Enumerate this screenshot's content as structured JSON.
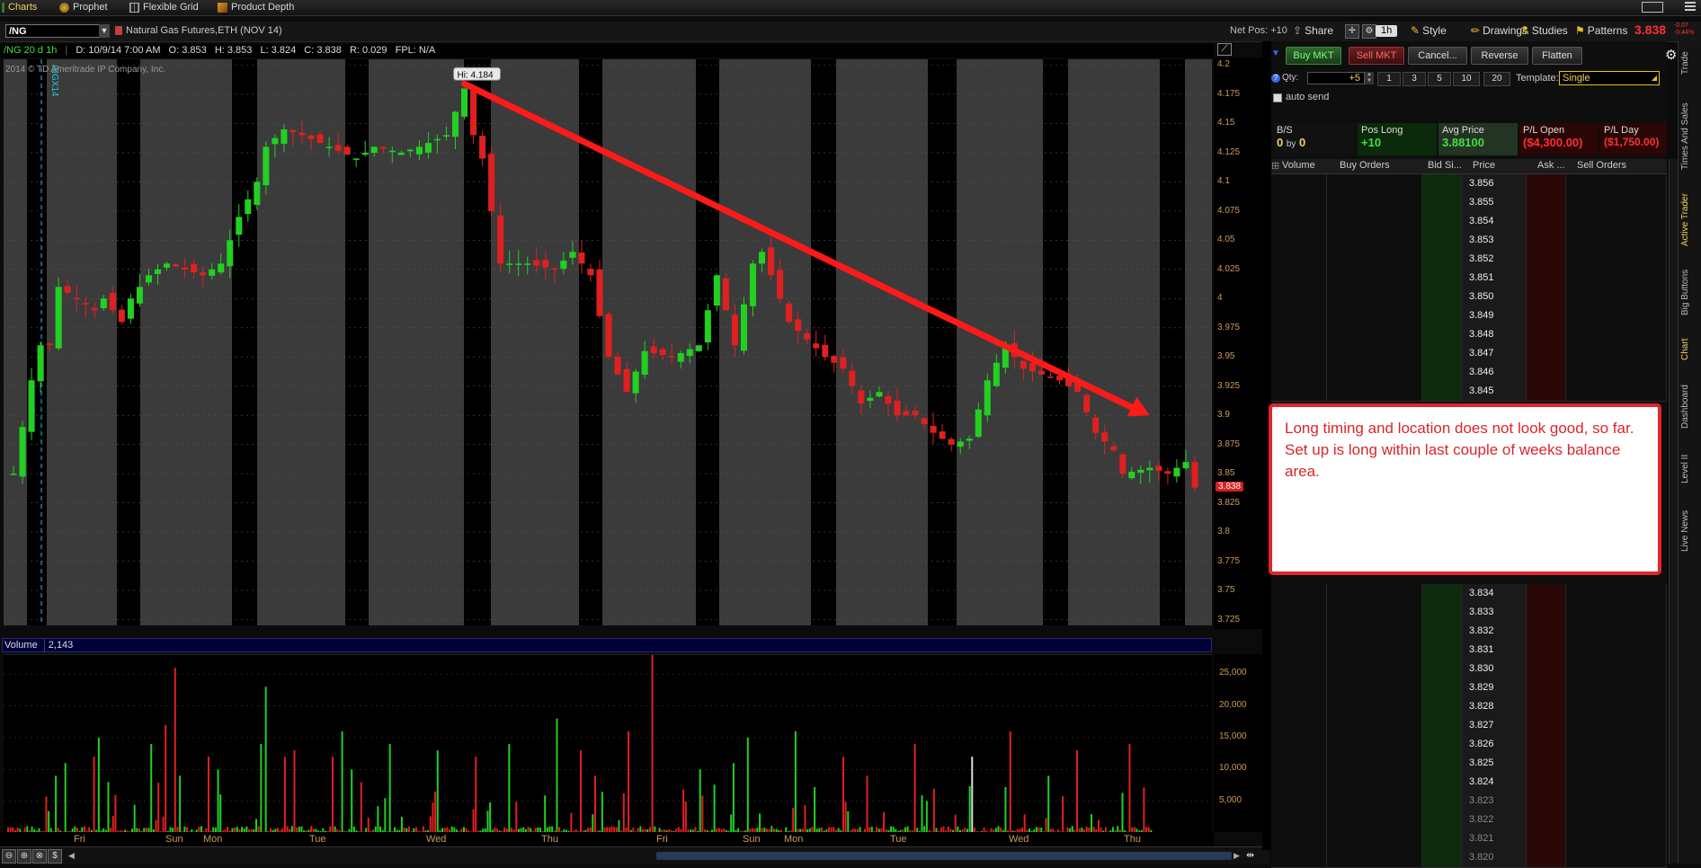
{
  "top_tabs": [
    {
      "label": "Charts",
      "icon": "chart-icon"
    },
    {
      "label": "Prophet",
      "icon": "prophet-icon"
    },
    {
      "label": "Flexible Grid",
      "icon": "grid-icon"
    },
    {
      "label": "Product Depth",
      "icon": "depth-icon"
    }
  ],
  "chart": {
    "symbol": "/NG",
    "description": "Natural Gas Futures,ETH (NOV 14)",
    "net_pos": "Net Pos: +10",
    "toolbar": {
      "share": "Share",
      "aggregation": "1h",
      "style": "Style",
      "drawings": "Drawings",
      "studies": "Studies",
      "patterns": "Patterns",
      "last_price": "3.838",
      "change_top": "-0.07",
      "change_bottom": "-0.44%"
    },
    "info": {
      "period": "/NG 20 d 1h",
      "date": "D: 10/9/14 7:00 AM",
      "open": "O: 3.853",
      "high": "H: 3.853",
      "low": "L: 3.824",
      "close": "C: 3.838",
      "range": "R: 0.029",
      "fpl": "FPL: N/A"
    },
    "copyright": "2014 © TD Ameritrade IP Company, Inc.",
    "vertical_marker_label": "/NGX14",
    "hi_label": "Hi: 4.184",
    "price_label": "3.838",
    "volume_label": "Volume",
    "volume_value": "2,143"
  },
  "chart_data": {
    "type": "candlestick",
    "price_axis": {
      "ticks": [
        "4.2",
        "4.175",
        "4.15",
        "4.125",
        "4.1",
        "4.075",
        "4.05",
        "4.025",
        "4",
        "3.975",
        "3.95",
        "3.925",
        "3.9",
        "3.875",
        "3.85",
        "3.825",
        "3.8",
        "3.775",
        "3.75",
        "3.725"
      ],
      "range": [
        3.72,
        4.205
      ]
    },
    "volume_axis": {
      "ticks": [
        "25,000",
        "20,000",
        "15,000",
        "10,000",
        "5,000"
      ],
      "range": [
        0,
        28000
      ]
    },
    "date_ticks": [
      "Fri",
      "Sun",
      "Mon",
      "Tue",
      "Wed",
      "Thu",
      "Fri",
      "Sun",
      "Mon",
      "Tue",
      "Wed",
      "Thu"
    ],
    "close_path": [
      [
        0,
        3.85
      ],
      [
        2,
        3.93
      ],
      [
        3,
        3.96
      ],
      [
        4,
        3.96
      ],
      [
        5,
        4.01
      ],
      [
        7,
        4.0
      ],
      [
        9,
        3.99
      ],
      [
        10,
        4.0
      ],
      [
        12,
        3.98
      ],
      [
        13,
        4.0
      ],
      [
        15,
        4.02
      ],
      [
        17,
        4.03
      ],
      [
        19,
        4.025
      ],
      [
        21,
        4.02
      ],
      [
        23,
        4.03
      ],
      [
        25,
        4.07
      ],
      [
        27,
        4.1
      ],
      [
        28,
        4.13
      ],
      [
        30,
        4.145
      ],
      [
        32,
        4.14
      ],
      [
        35,
        4.13
      ],
      [
        38,
        4.12
      ],
      [
        40,
        4.13
      ],
      [
        43,
        4.125
      ],
      [
        45,
        4.13
      ],
      [
        48,
        4.14
      ],
      [
        50,
        4.18
      ],
      [
        51,
        4.14
      ],
      [
        52,
        4.12
      ],
      [
        54,
        4.03
      ],
      [
        57,
        4.03
      ],
      [
        60,
        4.025
      ],
      [
        62,
        4.04
      ],
      [
        64,
        4.02
      ],
      [
        66,
        3.95
      ],
      [
        68,
        3.92
      ],
      [
        70,
        3.955
      ],
      [
        73,
        3.95
      ],
      [
        76,
        3.96
      ],
      [
        78,
        4.02
      ],
      [
        80,
        3.96
      ],
      [
        82,
        4.03
      ],
      [
        83,
        4.04
      ],
      [
        84,
        4.02
      ],
      [
        86,
        3.98
      ],
      [
        88,
        3.965
      ],
      [
        90,
        3.95
      ],
      [
        92,
        3.94
      ],
      [
        94,
        3.91
      ],
      [
        96,
        3.92
      ],
      [
        98,
        3.9
      ],
      [
        100,
        3.9
      ],
      [
        102,
        3.885
      ],
      [
        104,
        3.875
      ],
      [
        106,
        3.88
      ],
      [
        108,
        3.93
      ],
      [
        110,
        3.96
      ],
      [
        112,
        3.94
      ],
      [
        114,
        3.935
      ],
      [
        116,
        3.93
      ],
      [
        118,
        3.92
      ],
      [
        120,
        3.885
      ],
      [
        122,
        3.87
      ],
      [
        123,
        3.85
      ],
      [
        126,
        3.855
      ],
      [
        128,
        3.85
      ],
      [
        130,
        3.86
      ],
      [
        131,
        3.838
      ]
    ],
    "annotations": [
      {
        "type": "arrow",
        "from": [
          50,
          4.184
        ],
        "to": [
          126,
          3.9
        ]
      }
    ]
  },
  "order_entry": {
    "buttons": [
      "Buy MKT",
      "Sell MKT",
      "Cancel...",
      "Reverse",
      "Flatten"
    ],
    "qty_label": "Qty:",
    "qty_value": "+5",
    "qty_presets": [
      "1",
      "3",
      "5",
      "10",
      "20"
    ],
    "template_label": "Template:",
    "template_value": "Single",
    "auto_send": "auto send"
  },
  "position": {
    "bs_label": "B/S",
    "bs_value_a": "0",
    "bs_by": "by",
    "bs_value_b": "0",
    "pos_long_label": "Pos Long",
    "pos_long_value": "+10",
    "avg_price_label": "Avg Price",
    "avg_price_value": "3.88100",
    "pl_open_label": "P/L Open",
    "pl_open_value": "($4,300.00)",
    "pl_day_label": "P/L Day",
    "pl_day_value": "($1,750.00)"
  },
  "ladder": {
    "columns": [
      "Volume",
      "Buy Orders",
      "Bid Si...",
      "Price",
      "Ask ...",
      "Sell Orders"
    ],
    "prices_top": [
      "3.856",
      "3.855",
      "3.854",
      "3.853",
      "3.852",
      "3.851",
      "3.850",
      "3.849",
      "3.848",
      "3.847",
      "3.846",
      "3.845"
    ],
    "prices_bottom": [
      "3.834",
      "3.833",
      "3.832",
      "3.831",
      "3.830",
      "3.829",
      "3.828",
      "3.827",
      "3.826",
      "3.825",
      "3.824",
      "3.823",
      "3.822",
      "3.821",
      "3.820"
    ]
  },
  "annotation_note": "Long timing and location does not look good, so far. Set up is long within last couple of weeks balance area.",
  "side_tabs": [
    "Trade",
    "Times And Sales",
    "Active Trader",
    "Big Buttons",
    "Chart",
    "Dashboard",
    "Level II",
    "Live News"
  ],
  "colors": {
    "up": "#22d022",
    "down": "#e02020",
    "arrow": "#ff1a1a",
    "accent": "#e8c020"
  }
}
